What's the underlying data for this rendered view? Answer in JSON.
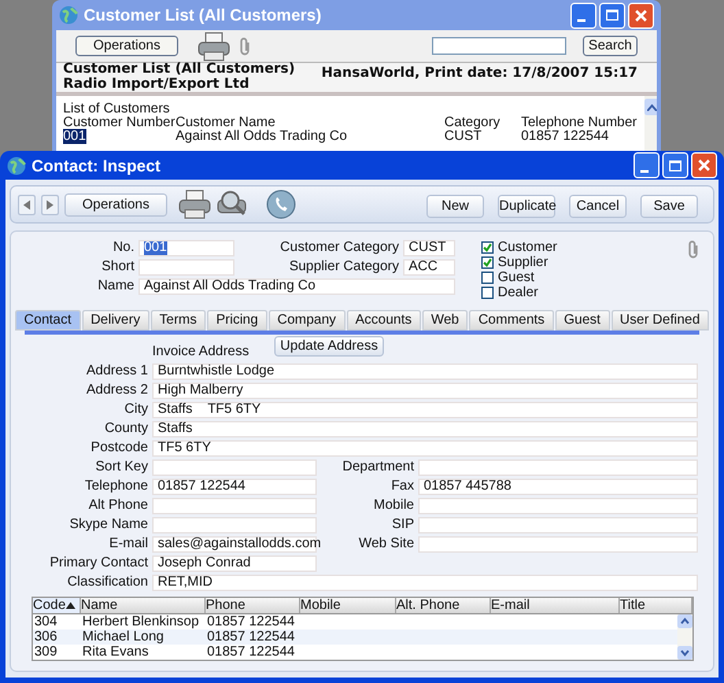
{
  "back_window": {
    "title": "Customer List (All Customers)",
    "operations_button": "Operations",
    "search_button": "Search",
    "report": {
      "title": "Customer List (All Customers)",
      "company": "Radio Import/Export Ltd",
      "print_info": "HansaWorld, Print date: 17/8/2007 15:17"
    },
    "list": {
      "heading": "List of Customers",
      "columns": [
        "Customer Number",
        "Customer Name",
        "Category",
        "Telephone Number"
      ],
      "rows": [
        {
          "cells": [
            "001",
            "Against All Odds Trading Co",
            "CUST",
            "01857 122544"
          ],
          "selected": true
        }
      ]
    }
  },
  "window": {
    "title": "Contact: Inspect"
  },
  "toolbar": {
    "operations_button": "Operations",
    "buttons": [
      "New",
      "Duplicate",
      "Cancel",
      "Save"
    ]
  },
  "header": {
    "fields": [
      {
        "label": "No.",
        "value": "001",
        "highlighted": true
      },
      {
        "label": "Short"
      }
    ],
    "category_fields": [
      {
        "label": "Customer Category",
        "value": "CUST"
      },
      {
        "label": "Supplier Category",
        "value": "ACC"
      }
    ],
    "name_field": {
      "label": "Name",
      "value": "Against All Odds Trading Co"
    },
    "checkboxes": [
      {
        "label": "Customer",
        "checked": true
      },
      {
        "label": "Supplier",
        "checked": true
      },
      {
        "label": "Guest",
        "checked": false
      },
      {
        "label": "Dealer",
        "checked": false
      }
    ]
  },
  "tabs": [
    {
      "label": "Contact",
      "selected": true
    },
    {
      "label": "Delivery",
      "selected": false
    },
    {
      "label": "Terms",
      "selected": false
    },
    {
      "label": "Pricing",
      "selected": false
    },
    {
      "label": "Company",
      "selected": false
    },
    {
      "label": "Accounts",
      "selected": false
    },
    {
      "label": "Web",
      "selected": false
    },
    {
      "label": "Comments",
      "selected": false
    },
    {
      "label": "Guest",
      "selected": false
    },
    {
      "label": "User Defined",
      "selected": false
    }
  ],
  "contact": {
    "update_button": "Update Address",
    "invoice_address_label": "Invoice Address",
    "address_fields": [
      {
        "label": "Address 1",
        "value": "Burntwhistle Lodge"
      },
      {
        "label": "Address 2",
        "value": "High Malberry"
      },
      {
        "label": "City",
        "value": "Staffs    TF5 6TY"
      },
      {
        "label": "County",
        "value": "Staffs"
      },
      {
        "label": "Postcode",
        "value": "TF5 6TY"
      }
    ],
    "pairs": [
      {
        "left": {
          "label": "Sort Key"
        },
        "right": {
          "label": "Department"
        }
      },
      {
        "left": {
          "label": "Telephone",
          "value": "01857 122544"
        },
        "right": {
          "label": "Fax",
          "value": "01857 445788"
        }
      },
      {
        "left": {
          "label": "Alt Phone"
        },
        "right": {
          "label": "Mobile"
        }
      },
      {
        "left": {
          "label": "Skype Name"
        },
        "right": {
          "label": "SIP"
        }
      },
      {
        "left": {
          "label": "E-mail",
          "value": "sales@againstallodds.com"
        },
        "right": {
          "label": "Web Site"
        }
      },
      {
        "left": {
          "label": "Primary Contact",
          "value": "Joseph Conrad"
        }
      }
    ],
    "classification": {
      "label": "Classification",
      "value": "RET,MID"
    }
  },
  "table": {
    "columns": [
      {
        "label": "Code",
        "sorted": true
      },
      {
        "label": "Name",
        "sorted": false
      },
      {
        "label": "Phone",
        "sorted": false
      },
      {
        "label": "Mobile",
        "sorted": false
      },
      {
        "label": "Alt. Phone",
        "sorted": false
      },
      {
        "label": "E-mail",
        "sorted": false
      },
      {
        "label": "Title",
        "sorted": false
      }
    ],
    "rows": [
      [
        "304",
        "Herbert Blenkinsop",
        "01857 122544"
      ],
      [
        "306",
        "Michael Long",
        "01857 122544"
      ],
      [
        "309",
        "Rita Evans",
        "01857 122544"
      ]
    ]
  }
}
